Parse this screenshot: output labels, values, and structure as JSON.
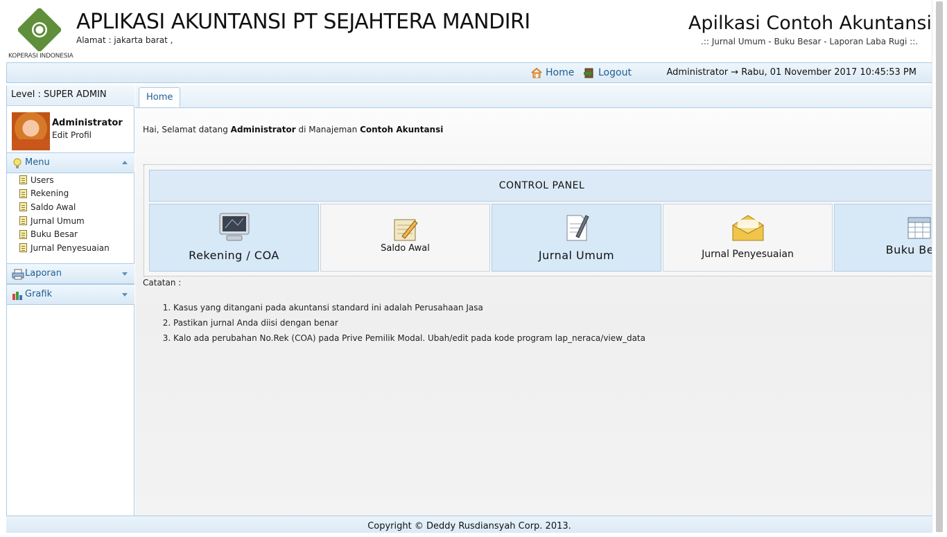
{
  "header": {
    "logo_caption": "KOPERASI INDONESIA",
    "app_title": "APLIKASI AKUNTANSI PT SEJAHTERA MANDIRI",
    "address": "Alamat : jakarta barat ,",
    "brand_title": "Apilkasi Contoh Akuntansi",
    "brand_subtitle": ".:: Jurnal Umum - Buku Besar - Laporan Laba Rugi ::."
  },
  "topbar": {
    "home_label": "Home",
    "logout_label": "Logout",
    "user_datetime": "Administrator → Rabu, 01 November 2017 10:45:53 PM",
    "icons": {
      "home": "house-icon",
      "logout": "logout-door-icon"
    }
  },
  "sidebar": {
    "level": "Level : SUPER ADMIN",
    "profile": {
      "name": "Administrator",
      "edit_label": "Edit Profil"
    },
    "menu": {
      "label": "Menu",
      "icon": "lightbulb-icon",
      "items": [
        {
          "label": "Users"
        },
        {
          "label": "Rekening"
        },
        {
          "label": "Saldo Awal"
        },
        {
          "label": "Jurnal Umum"
        },
        {
          "label": "Buku Besar"
        },
        {
          "label": "Jurnal Penyesuaian"
        }
      ]
    },
    "laporan": {
      "label": "Laporan",
      "icon": "printer-icon"
    },
    "grafik": {
      "label": "Grafik",
      "icon": "bar-chart-icon"
    }
  },
  "main": {
    "tab": "Home",
    "welcome": {
      "prefix": "Hai, Selamat datang",
      "user": "Administrator",
      "middle": "di Manajeman",
      "app": "Contoh Akuntansi"
    },
    "control_panel": {
      "title": "CONTROL PANEL",
      "tiles": [
        {
          "label": "Rekening / COA",
          "icon": "monitor-icon"
        },
        {
          "label": "Saldo Awal",
          "icon": "notepad-pencil-icon"
        },
        {
          "label": "Jurnal Umum",
          "icon": "document-pen-icon"
        },
        {
          "label": "Jurnal Penyesuaian",
          "icon": "envelope-icon"
        },
        {
          "label": "Buku Besar",
          "icon": "spreadsheet-icon"
        }
      ]
    },
    "catatan_label": "Catatan :",
    "notes": [
      "Kasus yang ditangani pada akuntansi standard ini adalah Perusahaan Jasa",
      "Pastikan jurnal Anda diisi dengan benar",
      "Kalo ada perubahan No.Rek (COA) pada Prive Pemilik Modal. Ubah/edit pada kode program lap_neraca/view_data"
    ]
  },
  "footer": {
    "copyright": "Copyright © Deddy Rusdiansyah Corp. 2013."
  },
  "colors": {
    "accent_blue": "#1f5d93",
    "panel_blue": "#d7e8f7",
    "border_blue": "#a9cbe6"
  }
}
